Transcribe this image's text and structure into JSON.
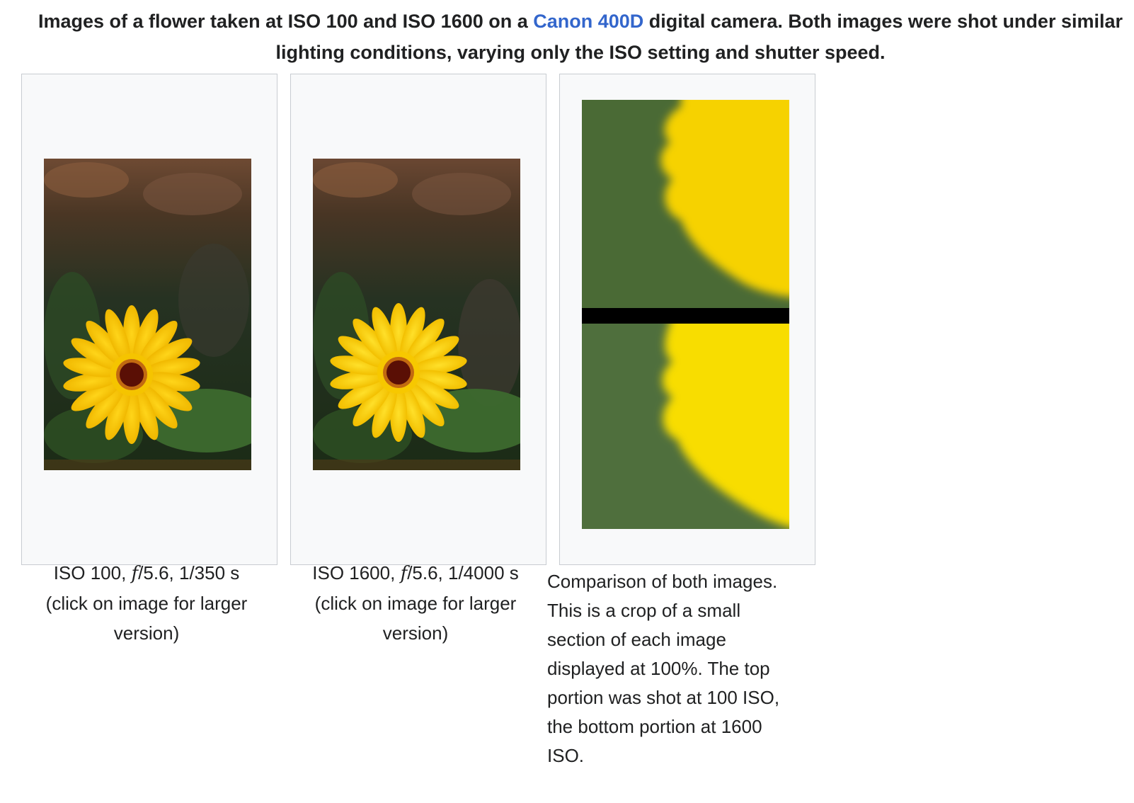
{
  "header": {
    "text_before_link": "Images of a flower taken at ISO 100 and ISO 1600 on a ",
    "link_text": "Canon 400D",
    "text_after_link": " digital camera. Both images were shot under similar lighting conditions, varying only the ISO setting and shutter speed."
  },
  "gallery": {
    "items": [
      {
        "image_alt": "Yellow flower shot at ISO 100",
        "caption_prefix": "ISO 100, ",
        "caption_italic": "f",
        "caption_suffix": "/5.6, 1/350 s",
        "caption_note": "(click on image for larger version)"
      },
      {
        "image_alt": "Yellow flower shot at ISO 1600",
        "caption_prefix": "ISO 1600, ",
        "caption_italic": "f",
        "caption_suffix": "/5.6, 1/4000 s",
        "caption_note": "(click on image for larger version)"
      },
      {
        "image_alt": "Crop comparison of ISO 100 and ISO 1600",
        "caption": "Comparison of both images. This is a crop of a small section of each image displayed at 100%. The top portion was shot at 100 ISO, the bottom portion at 1600 ISO."
      }
    ]
  },
  "colors": {
    "link": "#3366cc",
    "frame_border": "#c8ccd1",
    "frame_background": "#f8f9fa",
    "text": "#202122",
    "petal_yellow": "#f6c800",
    "foliage_green": "#3f5e33",
    "flower_center": "#5a0f05"
  }
}
